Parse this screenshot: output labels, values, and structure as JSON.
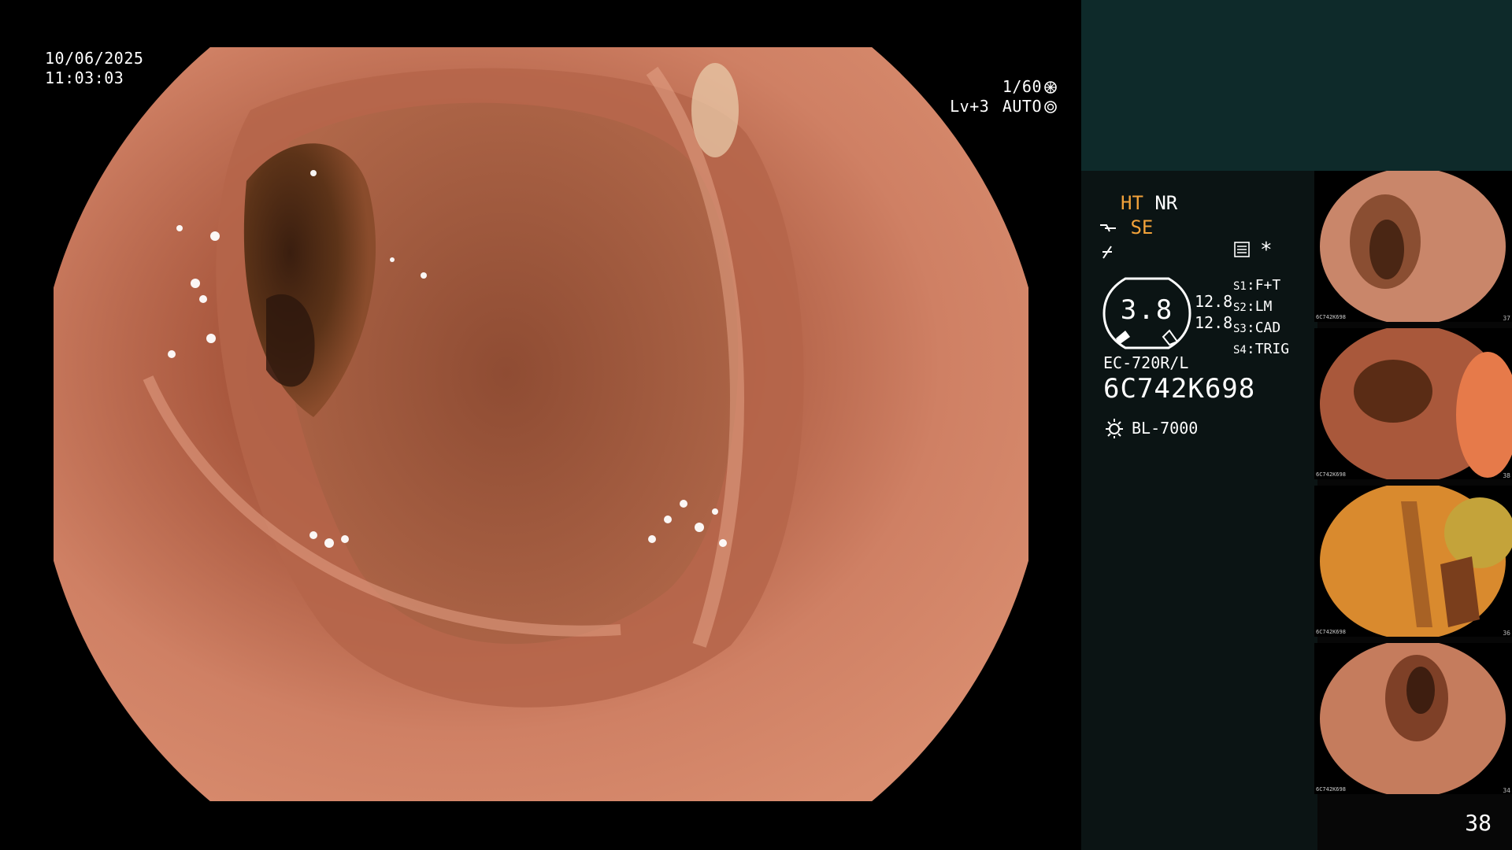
{
  "main": {
    "date": "10/06/2025",
    "time": "11:03:03",
    "shutter": "1/60",
    "level": "Lv+3",
    "iris": "AUTO"
  },
  "panel": {
    "mode_ht": "HT",
    "mode_nr": "NR",
    "mode_se": "SE",
    "gauge_value": "3.8",
    "bw_top": "12.8",
    "bw_bottom": "12.8",
    "s_keys": [
      "S1",
      "S2",
      "S3",
      "S4"
    ],
    "s_values": [
      "F+T",
      "LM",
      "CAD",
      "TRIG"
    ],
    "asterisk": "*",
    "scope_model": "EC-720R/L",
    "scope_serial": "6C742K698",
    "light_source": "BL-7000",
    "page_number": "38"
  },
  "thumbnails": [
    {
      "serial": "6C742K698",
      "index": "37"
    },
    {
      "serial": "6C742K698",
      "index": "38"
    },
    {
      "serial": "6C742K698",
      "index": "36"
    },
    {
      "serial": "6C742K698",
      "index": "34"
    }
  ],
  "colors": {
    "mode_accent": "#f2a23a",
    "panel_teal": "#0e2a2a",
    "tissue": "#c77b5f"
  }
}
